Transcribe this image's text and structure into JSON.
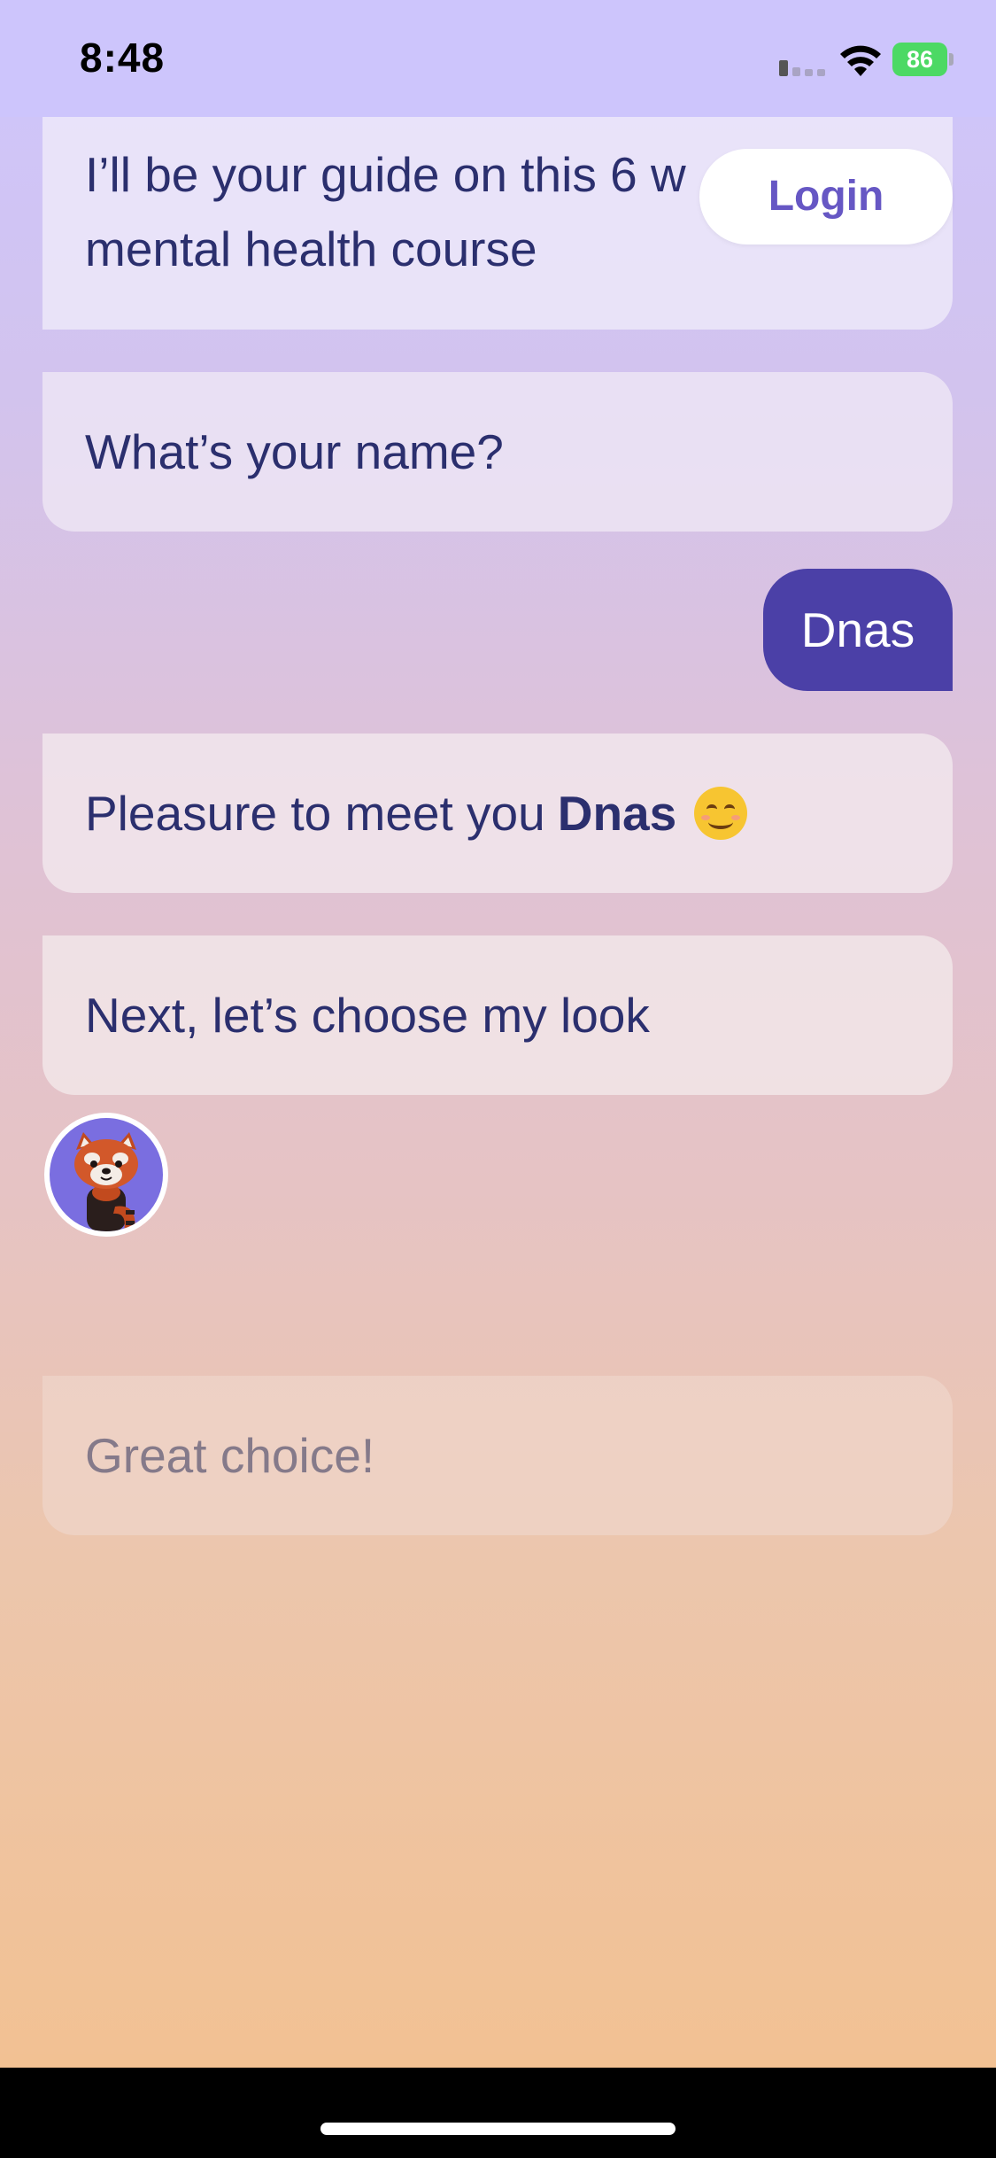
{
  "status_bar": {
    "time": "8:48",
    "battery_level": "86"
  },
  "header": {
    "login_label": "Login"
  },
  "messages": {
    "guide_intro": "I’ll be your guide on this 6 w",
    "guide_intro_line2": "mental health course",
    "ask_name": "What’s your name?",
    "user_reply": "Dnas",
    "greeting_prefix": "Pleasure to meet you",
    "greeting_name": "Dnas",
    "next_step": "Next, let’s choose my look",
    "confirmation": "Great choice!"
  },
  "avatar": {
    "icon": "red-panda-avatar-icon"
  },
  "colors": {
    "accent": "#4b40a7",
    "text": "#2b2f6e",
    "battery": "#4cd964"
  }
}
